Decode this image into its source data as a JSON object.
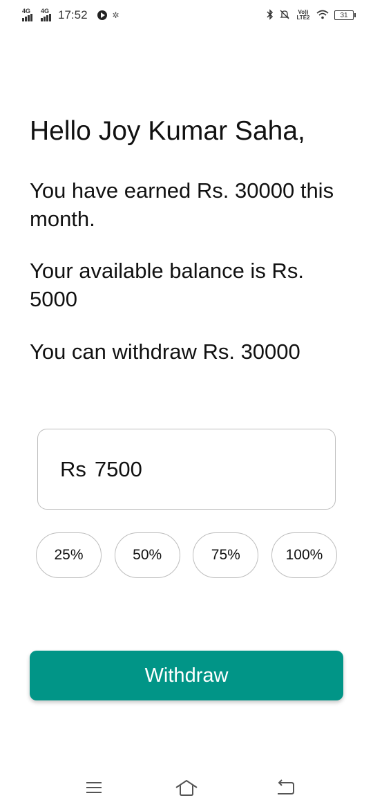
{
  "status_bar": {
    "network1": "4G",
    "network2": "4G",
    "time": "17:52",
    "volte": "Vo)) LTE2",
    "battery": "31",
    "icons": [
      "signal-icon",
      "signal-icon",
      "media-play-icon",
      "fan-icon",
      "bluetooth-icon",
      "mute-icon",
      "volte-icon",
      "wifi-icon",
      "battery-icon"
    ]
  },
  "greeting": "Hello Joy Kumar Saha,",
  "info": {
    "earned": "You have earned Rs. 30000 this month.",
    "balance": "Your available balance is Rs. 5000",
    "withdrawable": "You can withdraw Rs. 30000"
  },
  "amount_input": {
    "currency": "Rs",
    "value": "7500"
  },
  "percent_options": [
    "25%",
    "50%",
    "75%",
    "100%"
  ],
  "withdraw_button": "Withdraw",
  "colors": {
    "accent": "#019587",
    "border": "#bdbdbd",
    "text": "#111111"
  },
  "nav_bar": {
    "icons": [
      "menu-icon",
      "home-icon",
      "back-icon"
    ]
  }
}
